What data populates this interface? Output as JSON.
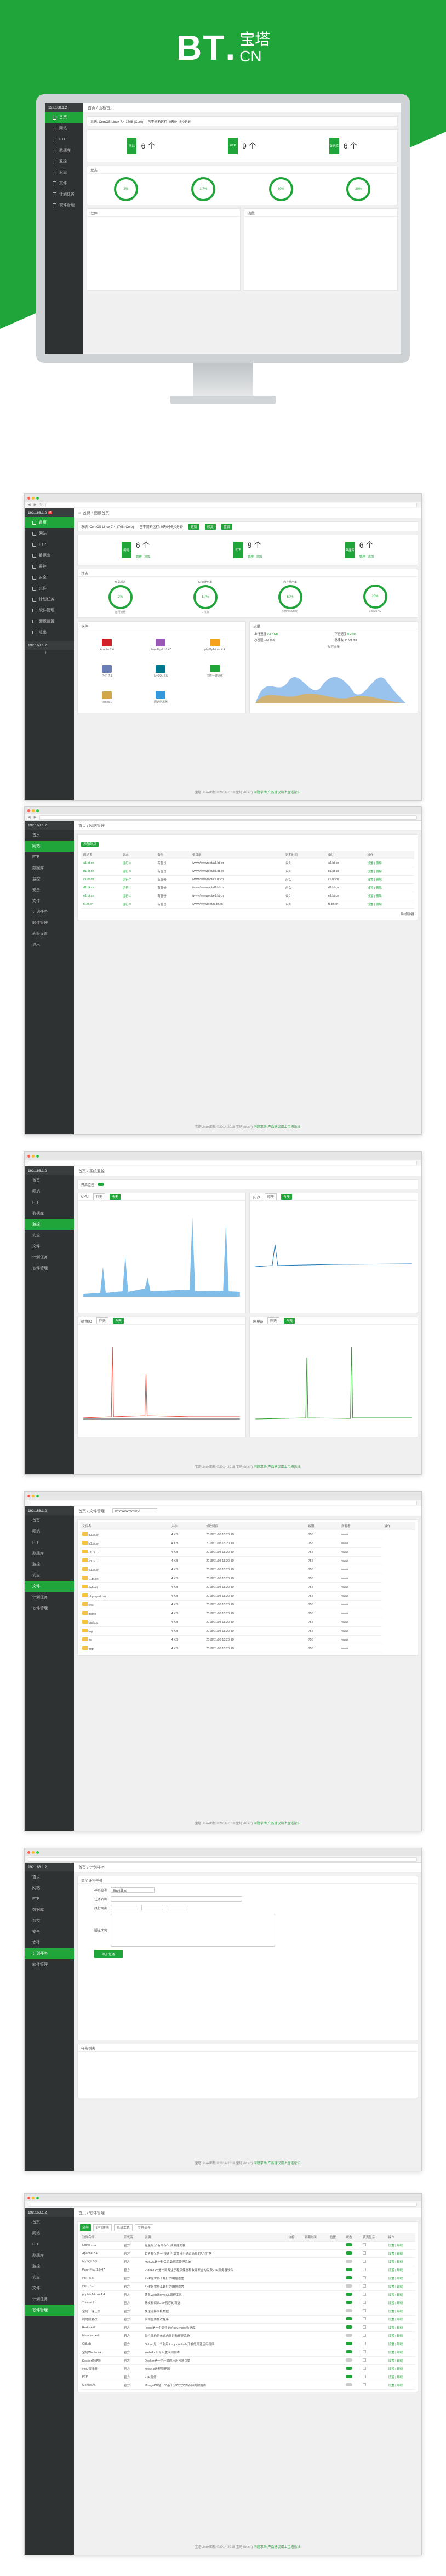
{
  "brand": {
    "logo_letters": "BT",
    "logo_dot": ".",
    "logo_cn": "宝塔",
    "logo_domain": "CN"
  },
  "side": {
    "server": "192.168.1.2",
    "badge": "0",
    "items": [
      "首页",
      "网站",
      "FTP",
      "数据库",
      "监控",
      "安全",
      "文件",
      "计划任务",
      "软件管理",
      "面板设置",
      "退出"
    ],
    "add": "+"
  },
  "home": {
    "crumb": "首页 / 面板首页",
    "sysinfo": "系统: CentOS Linux 7.4.1708 (Core)",
    "uptime": "已不间断运行: 0天0小时0分钟",
    "buttons": [
      "更新",
      "修复",
      "重启"
    ],
    "stats": [
      {
        "n": "6 个",
        "lbl": "网站",
        "a": "管理",
        "b": "添加"
      },
      {
        "n": "9 个",
        "lbl": "FTP",
        "a": "管理",
        "b": "添加"
      },
      {
        "n": "6 个",
        "lbl": "数据库",
        "a": "管理",
        "b": "添加"
      }
    ],
    "state_title": "状态",
    "gauges": [
      {
        "top": "负载状态",
        "v": "2%",
        "lbl": "运行流畅"
      },
      {
        "top": "CPU使用率",
        "v": "1.7%",
        "lbl": "1 核心"
      },
      {
        "top": "内存使用率",
        "v": "60%",
        "lbl": "579/970(MB)"
      },
      {
        "top": "/",
        "v": "20%",
        "lbl": "3.5G/17G"
      }
    ],
    "soft_title": "软件",
    "soft": [
      {
        "n": "Apache 2.4",
        "c": "#d22128"
      },
      {
        "n": "Pure-Ftpd 1.0.47",
        "c": "#9b59b6"
      },
      {
        "n": "phpMyAdmin 4.4",
        "c": "#f7a01d"
      },
      {
        "n": "PHP-7.1",
        "c": "#6c7eb7"
      },
      {
        "n": "MySQL 5.5",
        "c": "#00758f"
      },
      {
        "n": "宝塔一键迁移",
        "c": "#20a53a"
      },
      {
        "n": "Tomcat 7",
        "c": "#d1a74a"
      },
      {
        "n": "网站防篡改",
        "c": "#3498db"
      }
    ],
    "traffic_title": "流量",
    "traffic": {
      "up": "上行速度",
      "up_v": "0.17 KB",
      "down": "下行速度",
      "down_v": "0.2 KB",
      "total_up": "总发送",
      "total_up_v": "152 MB",
      "total_down": "总接收",
      "total_down_v": "44.09 MB",
      "chart": "实时流量"
    }
  },
  "site": {
    "crumb": "首页 / 网站管理",
    "add": "添加站点",
    "headers": [
      "网站名",
      "状态",
      "备份",
      "根目录",
      "到期时间",
      "备注",
      "操作"
    ],
    "rows": [
      [
        "a1.bt.cn",
        "运行中",
        "有备份",
        "/www/wwwroot/a1.bt.cn",
        "永久",
        "a1.bt.cn",
        "设置 | 删除"
      ],
      [
        "b1.bt.cn",
        "运行中",
        "有备份",
        "/www/wwwroot/b1.bt.cn",
        "永久",
        "b1.bt.cn",
        "设置 | 删除"
      ],
      [
        "c1.bt.cn",
        "运行中",
        "有备份",
        "/www/wwwroot/c1.bt.cn",
        "永久",
        "c1.bt.cn",
        "设置 | 删除"
      ],
      [
        "d1.bt.cn",
        "运行中",
        "有备份",
        "/www/wwwroot/d1.bt.cn",
        "永久",
        "d1.bt.cn",
        "设置 | 删除"
      ],
      [
        "e1.bt.cn",
        "运行中",
        "有备份",
        "/www/wwwroot/e1.bt.cn",
        "永久",
        "e1.bt.cn",
        "设置 | 删除"
      ],
      [
        "f1.bt.cn",
        "运行中",
        "有备份",
        "/www/wwwroot/f1.bt.cn",
        "永久",
        "f1.bt.cn",
        "设置 | 删除"
      ]
    ],
    "pager": "共6条数据"
  },
  "monitor": {
    "crumb": "首页 / 系统监控",
    "toggle_label": "开启监控",
    "cpu": "CPU",
    "mem": "内存",
    "io": "磁盘IO",
    "net": "网络io",
    "ranges": [
      "昨天",
      "今天",
      "最近7天",
      "自定义时间"
    ]
  },
  "files": {
    "crumb": "首页 / 文件管理",
    "path": "/www/wwwroot",
    "headers": [
      "文件名",
      "大小",
      "修改时间",
      "权限",
      "所有者",
      "操作"
    ],
    "rows": [
      [
        "a1.bt.cn",
        "4 KB",
        "2018/01/03 15:20:10",
        "755",
        "www"
      ],
      [
        "b1.bt.cn",
        "4 KB",
        "2018/01/03 15:20:10",
        "755",
        "www"
      ],
      [
        "c1.bt.cn",
        "4 KB",
        "2018/01/03 15:20:10",
        "755",
        "www"
      ],
      [
        "d1.bt.cn",
        "4 KB",
        "2018/01/03 15:20:10",
        "755",
        "www"
      ],
      [
        "e1.bt.cn",
        "4 KB",
        "2018/01/03 15:20:10",
        "755",
        "www"
      ],
      [
        "f1.bt.cn",
        "4 KB",
        "2018/01/03 15:20:10",
        "755",
        "www"
      ],
      [
        "default",
        "4 KB",
        "2018/01/03 15:20:10",
        "755",
        "www"
      ],
      [
        "phpmyadmin",
        "4 KB",
        "2018/01/03 15:20:10",
        "755",
        "www"
      ],
      [
        "test",
        "4 KB",
        "2018/01/03 15:20:10",
        "755",
        "www"
      ],
      [
        "demo",
        "4 KB",
        "2018/01/03 15:20:10",
        "755",
        "www"
      ],
      [
        "backup",
        "4 KB",
        "2018/01/03 15:20:10",
        "755",
        "www"
      ],
      [
        "log",
        "4 KB",
        "2018/01/03 15:20:10",
        "755",
        "www"
      ],
      [
        "ssl",
        "4 KB",
        "2018/01/03 15:20:10",
        "755",
        "www"
      ],
      [
        "tmp",
        "4 KB",
        "2018/01/03 15:20:10",
        "755",
        "www"
      ]
    ]
  },
  "cron": {
    "crumb": "首页 / 计划任务",
    "title": "添加计划任务",
    "type_label": "任务类型",
    "type_val": "Shell脚本",
    "name_label": "任务名称",
    "cycle_label": "执行周期",
    "script_label": "脚本内容",
    "submit": "添加任务",
    "list_title": "任务列表"
  },
  "softmgr": {
    "crumb": "首页 / 软件管理",
    "tabs": [
      "全部",
      "运行环境",
      "系统工具",
      "宝塔插件"
    ],
    "headers": [
      "软件名称",
      "开发商",
      "说明",
      "价格",
      "到期时间",
      "位置",
      "状态",
      "首页显示",
      "操作"
    ],
    "rows": [
      [
        "Nginx 1.12",
        "官方",
        "轻量级,占有内存少,并发能力强"
      ],
      [
        "Apache 2.4",
        "官方",
        "世界排名第一,快速,可靠并且可通过简单的API扩充"
      ],
      [
        "MySQL 5.5",
        "官方",
        "MySQL是一种关系数据库管理系统"
      ],
      [
        "Pure-Ftpd 1.0.47",
        "官方",
        "PureFTPd是一款专注于程序健壮和软件安全的免费FTP服务器软件"
      ],
      [
        "PHP-5.6",
        "官方",
        "PHP是世界上最好的编程语言"
      ],
      [
        "PHP-7.1",
        "官方",
        "PHP是世界上最好的编程语言"
      ],
      [
        "phpMyAdmin 4.4",
        "官方",
        "著名Web端MySQL管理工具"
      ],
      [
        "Tomcat 7",
        "官方",
        "开发和调试JSP程序的首选"
      ],
      [
        "宝塔一键迁移",
        "官方",
        "快速迁移面板数据"
      ],
      [
        "网站防篡改",
        "官方",
        "事件型防篡改程序"
      ],
      [
        "Redis 4.0",
        "官方",
        "Redis是一个高性能的key-value数据库"
      ],
      [
        "Memcached",
        "官方",
        "高性能的分布式内存对象缓存系统"
      ],
      [
        "GitLab",
        "官方",
        "GitLab是一个利用Ruby on Rails开发的开源应用程序"
      ],
      [
        "宝塔WebHook",
        "官方",
        "WebHook,可设置回调脚本"
      ],
      [
        "Docker管理器",
        "官方",
        "Docker是一个开源的应用容器引擎"
      ],
      [
        "PM2管理器",
        "官方",
        "Node.js进程管理器"
      ],
      [
        "FTP",
        "官方",
        "FTP服务"
      ],
      [
        "MongoDB",
        "官方",
        "MongoDB是一个基于分布式文件存储的数据库"
      ]
    ],
    "op": "设置 | 卸载"
  },
  "footer": {
    "text": "宝塔Linux面板 ©2014-2018 宝塔 (bt.cn)",
    "link": "问题求助|产品建议请上宝塔论坛"
  },
  "colors": {
    "brand": "#20a53a",
    "sidebar": "#2f3233"
  }
}
